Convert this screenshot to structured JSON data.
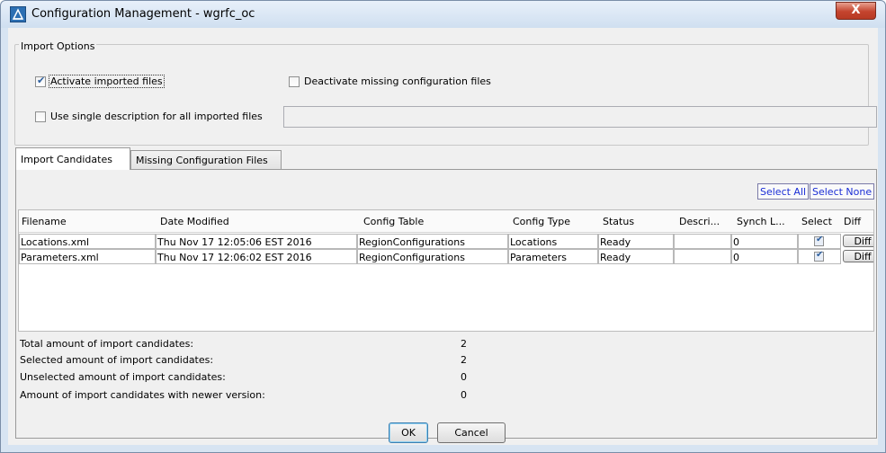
{
  "window": {
    "title": "Configuration Management - wgrfc_oc",
    "close_glyph": "X",
    "icon": "app-icon"
  },
  "import_options": {
    "title": "Import Options",
    "activate_label": "Activate imported files",
    "activate_checked": true,
    "deactivate_label": "Deactivate missing configuration files",
    "deactivate_checked": false,
    "single_desc_label": "Use single description for all imported files",
    "single_desc_checked": false,
    "description_value": ""
  },
  "tabs": [
    {
      "label": "Import Candidates",
      "active": true
    },
    {
      "label": "Missing Configuration Files",
      "active": false
    }
  ],
  "actions": {
    "select_all": "Select All",
    "select_none": "Select None"
  },
  "table": {
    "columns": [
      "Filename",
      "Date Modified",
      "Config Table",
      "Config Type",
      "Status",
      "Descri...",
      "Synch L...",
      "Select",
      "Diff"
    ],
    "rows": [
      {
        "filename": "Locations.xml",
        "date_modified": "Thu Nov 17 12:05:06 EST 2016",
        "config_table": "RegionConfigurations",
        "config_type": "Locations",
        "status": "Ready",
        "description": "",
        "synch_level": "0",
        "selected": true,
        "diff": "Diff"
      },
      {
        "filename": "Parameters.xml",
        "date_modified": "Thu Nov 17 12:06:02 EST 2016",
        "config_table": "RegionConfigurations",
        "config_type": "Parameters",
        "status": "Ready",
        "description": "",
        "synch_level": "0",
        "selected": true,
        "diff": "Diff"
      }
    ]
  },
  "stats": [
    {
      "label": "Total amount of import candidates:",
      "value": "2"
    },
    {
      "label": "Selected amount of import candidates:",
      "value": "2"
    },
    {
      "label": "Unselected amount of import candidates:",
      "value": "0"
    },
    {
      "label": "Amount of import candidates with newer version:",
      "value": "0"
    }
  ],
  "footer": {
    "ok": "OK",
    "cancel": "Cancel"
  },
  "colors": {
    "link": "#1b2ed6",
    "titlebar": "#cfdff0",
    "close_button": "#c4442e"
  }
}
